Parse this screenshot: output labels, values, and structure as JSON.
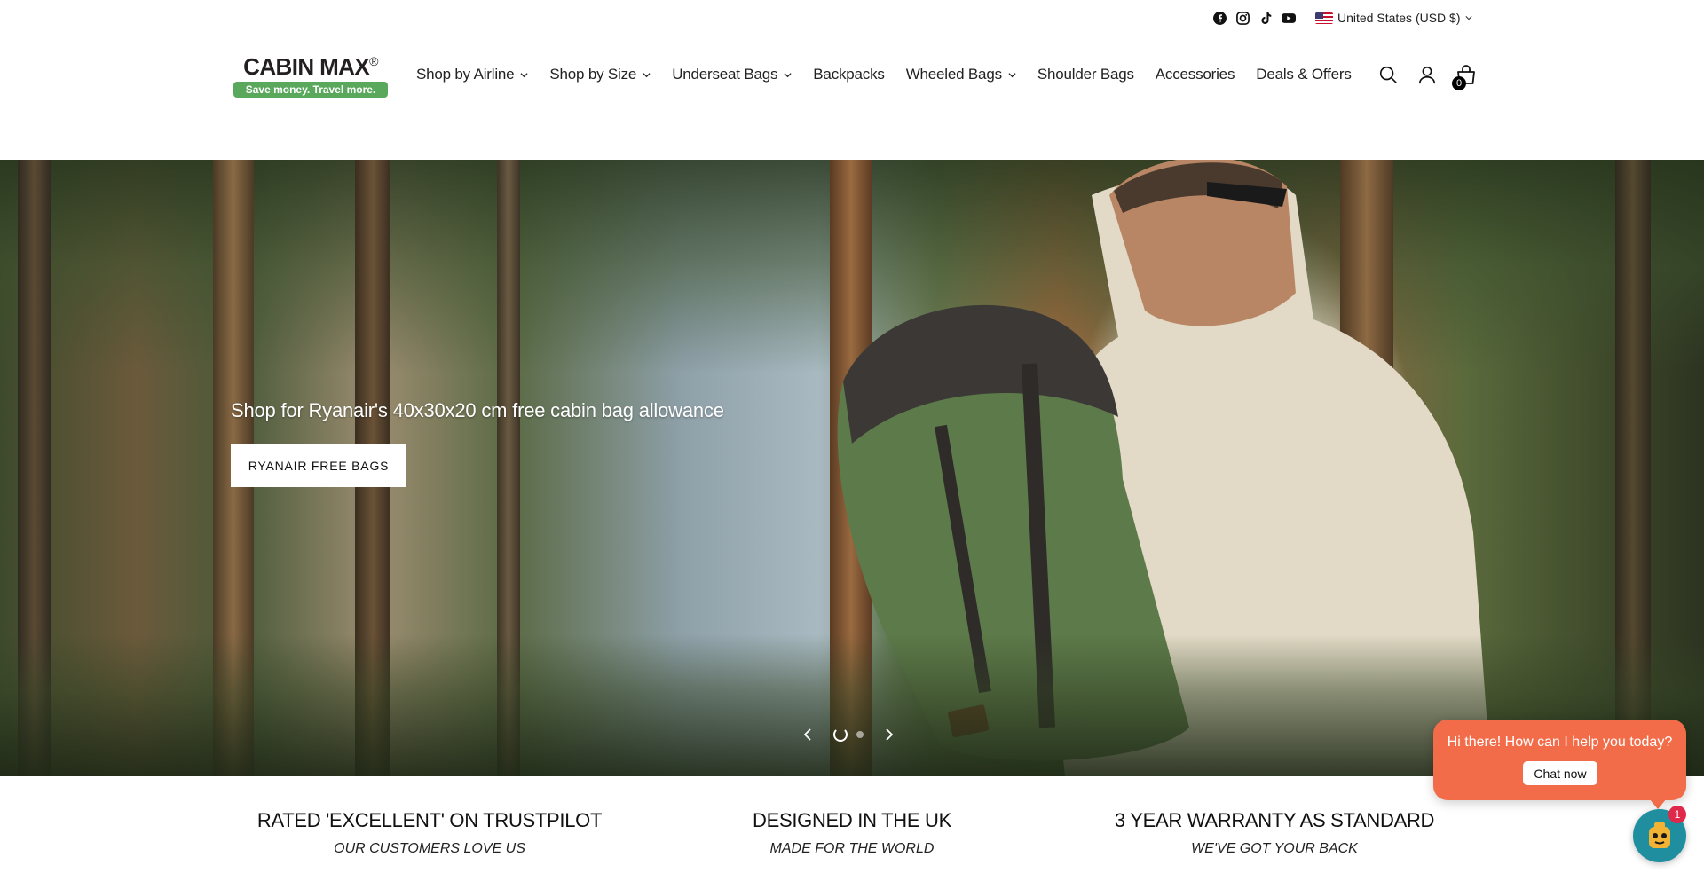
{
  "topbar": {
    "social": [
      {
        "icon": "facebook-icon"
      },
      {
        "icon": "instagram-icon"
      },
      {
        "icon": "tiktok-icon"
      },
      {
        "icon": "youtube-icon"
      }
    ],
    "region_label": "United States (USD $)"
  },
  "logo": {
    "wordmark": "CABIN MAX",
    "registered": "®",
    "tagline": "Save money. Travel more."
  },
  "nav": {
    "items": [
      {
        "label": "Shop by Airline",
        "has_dropdown": true
      },
      {
        "label": "Shop by Size",
        "has_dropdown": true
      },
      {
        "label": "Underseat Bags",
        "has_dropdown": true
      },
      {
        "label": "Backpacks",
        "has_dropdown": false
      },
      {
        "label": "Wheeled Bags",
        "has_dropdown": true
      },
      {
        "label": "Shoulder Bags",
        "has_dropdown": false
      },
      {
        "label": "Accessories",
        "has_dropdown": false
      },
      {
        "label": "Deals & Offers",
        "has_dropdown": false
      }
    ]
  },
  "header_icons": {
    "search": "search-icon",
    "account": "account-icon",
    "cart": "cart-icon",
    "cart_count": "0"
  },
  "hero": {
    "heading": "Shop for Ryanair's 40x30x20 cm free cabin bag allowance",
    "cta_label": "RYANAIR FREE BAGS",
    "slide_count": 2,
    "active_slide": 1
  },
  "features": [
    {
      "title": "RATED 'EXCELLENT' ON TRUSTPILOT",
      "subtitle": "OUR CUSTOMERS LOVE US"
    },
    {
      "title": "DESIGNED IN THE UK",
      "subtitle": "MADE FOR THE WORLD"
    },
    {
      "title": "3 YEAR WARRANTY AS STANDARD",
      "subtitle": "WE'VE GOT YOUR BACK"
    }
  ],
  "chat": {
    "message": "Hi there! How can I help you today?",
    "button_label": "Chat now",
    "badge_count": "1"
  },
  "colors": {
    "chat_accent": "#f36c49",
    "logo_green": "#5aa85c",
    "chat_launcher": "#1f8fa0"
  }
}
